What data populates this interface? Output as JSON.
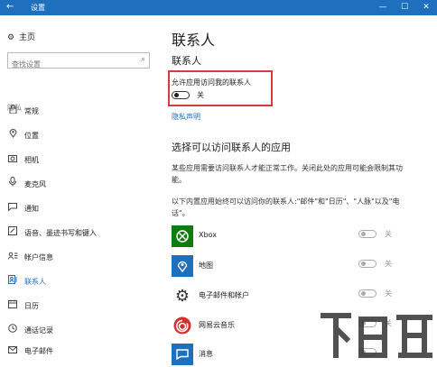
{
  "window": {
    "title": "设置",
    "back_glyph": "←",
    "minimize_glyph": "—",
    "maximize_glyph": "☐",
    "close_glyph": "✕"
  },
  "sidebar": {
    "home_label": "主页",
    "search_placeholder": "查找设置",
    "section_label": "隐私",
    "items": [
      {
        "label": "常规",
        "icon": "lock-icon"
      },
      {
        "label": "位置",
        "icon": "location-pin-icon"
      },
      {
        "label": "相机",
        "icon": "camera-icon"
      },
      {
        "label": "麦克风",
        "icon": "microphone-icon"
      },
      {
        "label": "通知",
        "icon": "notification-bubble-icon"
      },
      {
        "label": "语音、墨迹书写和键入",
        "icon": "speech-ink-icon"
      },
      {
        "label": "帐户信息",
        "icon": "account-info-icon"
      },
      {
        "label": "联系人",
        "icon": "contacts-icon",
        "active": true
      },
      {
        "label": "日历",
        "icon": "calendar-icon"
      },
      {
        "label": "通话记录",
        "icon": "call-history-icon"
      },
      {
        "label": "电子邮件",
        "icon": "email-icon"
      }
    ]
  },
  "main": {
    "page_title": "联系人",
    "section_title": "联系人",
    "permission_label": "允许应用访问我的联系人",
    "permission_state": "关",
    "privacy_link": "隐私声明",
    "apps_heading": "选择可以访问联系人的应用",
    "desc1": "某些应用需要访问联系人才能正常工作。关闭此处的应用可能会限制其功能。",
    "desc2": "以下内置应用始终可以访问你的联系人:\"邮件\"和\"日历\"、\"人脉\"以及\"电话\"。",
    "apps": [
      {
        "name": "Xbox",
        "state": "关",
        "icon": "xbox-icon",
        "color": "#107c10"
      },
      {
        "name": "地图",
        "state": "关",
        "icon": "maps-icon",
        "color": "#1f6fbf"
      },
      {
        "name": "电子邮件和帐户",
        "state": "关",
        "icon": "gear-icon",
        "color": "#3a3a3a"
      },
      {
        "name": "网易云音乐",
        "state": "关",
        "icon": "netease-music-icon",
        "color": "#d32f2f"
      },
      {
        "name": "消息",
        "state": "",
        "icon": "message-icon",
        "color": "#1f6fbf"
      }
    ]
  },
  "watermark": {
    "text": "下载吧"
  },
  "colors": {
    "accent": "#1f6fbf",
    "highlight_box": "#d83b3b"
  }
}
